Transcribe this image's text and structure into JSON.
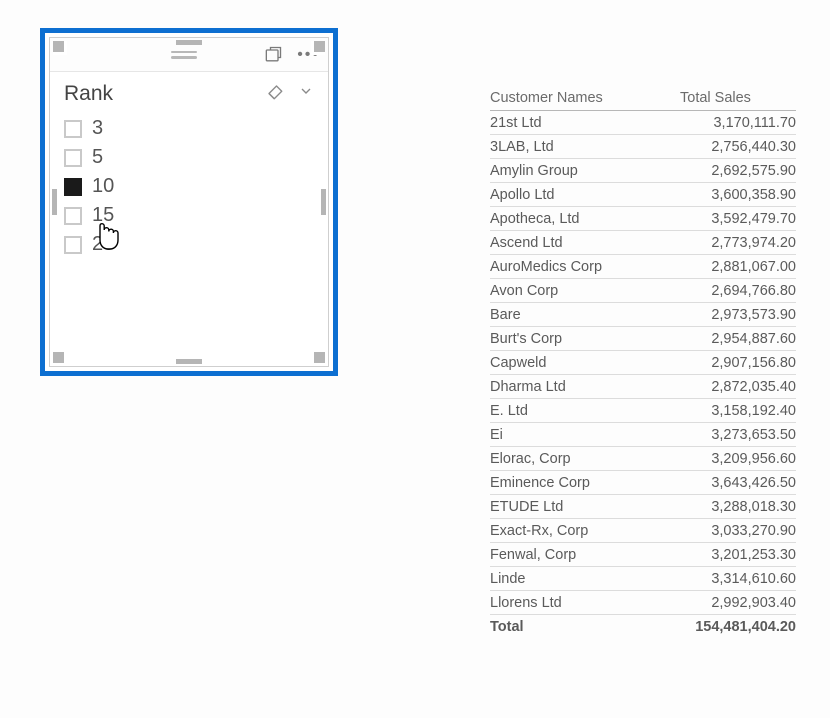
{
  "slicer": {
    "title": "Rank",
    "items": [
      {
        "label": "3",
        "checked": false
      },
      {
        "label": "5",
        "checked": false
      },
      {
        "label": "10",
        "checked": true
      },
      {
        "label": "15",
        "checked": false
      },
      {
        "label": "20",
        "checked": false
      }
    ]
  },
  "table": {
    "columns": {
      "name": "Customer Names",
      "value": "Total Sales"
    },
    "rows": [
      {
        "name": "21st Ltd",
        "value": "3,170,111.70"
      },
      {
        "name": "3LAB, Ltd",
        "value": "2,756,440.30"
      },
      {
        "name": "Amylin Group",
        "value": "2,692,575.90"
      },
      {
        "name": "Apollo Ltd",
        "value": "3,600,358.90"
      },
      {
        "name": "Apotheca, Ltd",
        "value": "3,592,479.70"
      },
      {
        "name": "Ascend Ltd",
        "value": "2,773,974.20"
      },
      {
        "name": "AuroMedics Corp",
        "value": "2,881,067.00"
      },
      {
        "name": "Avon Corp",
        "value": "2,694,766.80"
      },
      {
        "name": "Bare",
        "value": "2,973,573.90"
      },
      {
        "name": "Burt's Corp",
        "value": "2,954,887.60"
      },
      {
        "name": "Capweld",
        "value": "2,907,156.80"
      },
      {
        "name": "Dharma Ltd",
        "value": "2,872,035.40"
      },
      {
        "name": "E. Ltd",
        "value": "3,158,192.40"
      },
      {
        "name": "Ei",
        "value": "3,273,653.50"
      },
      {
        "name": "Elorac, Corp",
        "value": "3,209,956.60"
      },
      {
        "name": "Eminence Corp",
        "value": "3,643,426.50"
      },
      {
        "name": "ETUDE Ltd",
        "value": "3,288,018.30"
      },
      {
        "name": "Exact-Rx, Corp",
        "value": "3,033,270.90"
      },
      {
        "name": "Fenwal, Corp",
        "value": "3,201,253.30"
      },
      {
        "name": "Linde",
        "value": "3,314,610.60"
      },
      {
        "name": "Llorens Ltd",
        "value": "2,992,903.40"
      }
    ],
    "total": {
      "label": "Total",
      "value": "154,481,404.20"
    }
  }
}
